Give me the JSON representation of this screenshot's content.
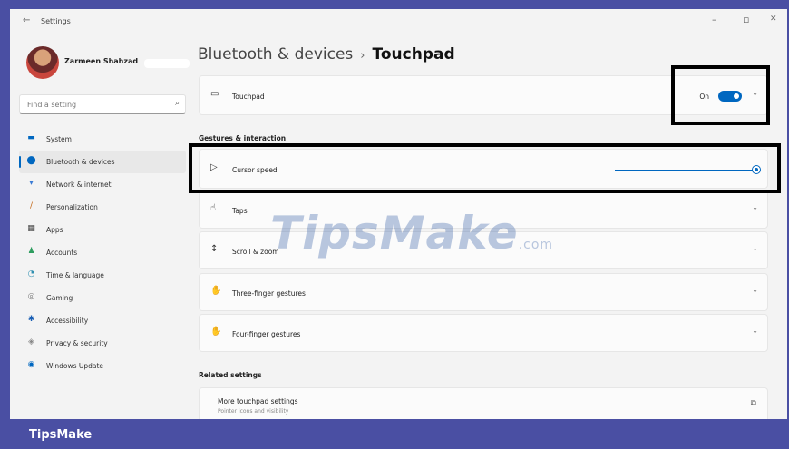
{
  "window": {
    "back_icon": "←",
    "app_title": "Settings",
    "minimize": "–",
    "maximize": "▫",
    "close": "✕"
  },
  "profile": {
    "name": "Zarmeen Shahzad"
  },
  "search": {
    "placeholder": "Find a setting",
    "icon": "⌕"
  },
  "nav": {
    "items": [
      {
        "label": "System",
        "icon": "▬",
        "color": "#0067c0"
      },
      {
        "label": "Bluetooth & devices",
        "icon": "⬤",
        "color": "#0067c0",
        "active": true
      },
      {
        "label": "Network & internet",
        "icon": "▾",
        "color": "#3a7bd5"
      },
      {
        "label": "Personalization",
        "icon": "/",
        "color": "#c46a1b"
      },
      {
        "label": "Apps",
        "icon": "▦",
        "color": "#444"
      },
      {
        "label": "Accounts",
        "icon": "♟",
        "color": "#2e9d5f"
      },
      {
        "label": "Time & language",
        "icon": "◔",
        "color": "#2f8fb0"
      },
      {
        "label": "Gaming",
        "icon": "◎",
        "color": "#777"
      },
      {
        "label": "Accessibility",
        "icon": "✱",
        "color": "#1a5fb4"
      },
      {
        "label": "Privacy & security",
        "icon": "◈",
        "color": "#888"
      },
      {
        "label": "Windows Update",
        "icon": "◉",
        "color": "#0067c0"
      }
    ]
  },
  "breadcrumb": {
    "parent": "Bluetooth & devices",
    "sep": "›",
    "current": "Touchpad"
  },
  "touchpad_card": {
    "label": "Touchpad",
    "icon": "▭",
    "toggle_text": "On",
    "chevron": "⌄"
  },
  "gestures_header": "Gestures & interaction",
  "cursor_card": {
    "label": "Cursor speed",
    "icon": "▷"
  },
  "taps_card": {
    "label": "Taps",
    "icon": "☝",
    "chevron": "⌄"
  },
  "scroll_card": {
    "label": "Scroll & zoom",
    "icon": "↕",
    "chevron": "⌄"
  },
  "three_card": {
    "label": "Three-finger gestures",
    "icon": "✋",
    "chevron": "⌄"
  },
  "four_card": {
    "label": "Four-finger gestures",
    "icon": "✋",
    "chevron": "⌄"
  },
  "related_header": "Related settings",
  "more_card": {
    "label": "More touchpad settings",
    "sub": "Pointer icons and visibility",
    "icon": "⧉"
  },
  "watermark": {
    "main": "TipsMake",
    "suffix": ".com"
  },
  "footer": {
    "brand": "TipsMake"
  }
}
